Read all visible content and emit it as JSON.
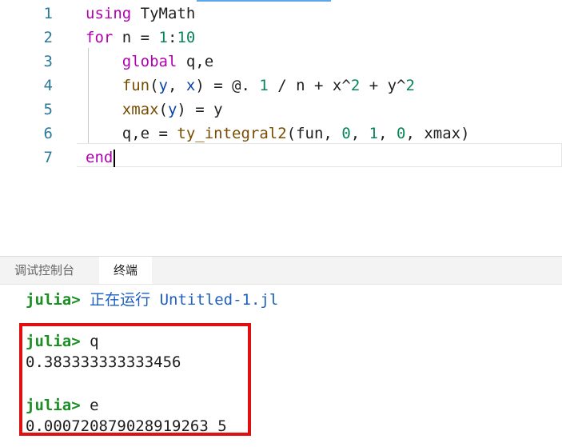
{
  "editor": {
    "lines": [
      {
        "num": "1",
        "parts": [
          {
            "t": "using",
            "c": "kw"
          },
          {
            "t": " TyMath",
            "c": ""
          }
        ]
      },
      {
        "num": "2",
        "parts": [
          {
            "t": "for",
            "c": "kw"
          },
          {
            "t": " n = ",
            "c": ""
          },
          {
            "t": "1",
            "c": "num"
          },
          {
            "t": ":",
            "c": ""
          },
          {
            "t": "10",
            "c": "num"
          }
        ]
      },
      {
        "num": "3",
        "parts": [
          {
            "t": "    global",
            "c": "kw"
          },
          {
            "t": " q,e",
            "c": ""
          }
        ]
      },
      {
        "num": "4",
        "parts": [
          {
            "t": "    fun",
            "c": "fn"
          },
          {
            "t": "(",
            "c": ""
          },
          {
            "t": "y",
            "c": "var"
          },
          {
            "t": ", ",
            "c": ""
          },
          {
            "t": "x",
            "c": "var"
          },
          {
            "t": ") = @. ",
            "c": ""
          },
          {
            "t": "1",
            "c": "num"
          },
          {
            "t": " / n + x^",
            "c": ""
          },
          {
            "t": "2",
            "c": "num"
          },
          {
            "t": " + y^",
            "c": ""
          },
          {
            "t": "2",
            "c": "num"
          }
        ]
      },
      {
        "num": "5",
        "parts": [
          {
            "t": "    xmax",
            "c": "fn"
          },
          {
            "t": "(",
            "c": ""
          },
          {
            "t": "y",
            "c": "var"
          },
          {
            "t": ") = y",
            "c": ""
          }
        ]
      },
      {
        "num": "6",
        "parts": [
          {
            "t": "    q,e = ",
            "c": ""
          },
          {
            "t": "ty_integral2",
            "c": "fn"
          },
          {
            "t": "(fun, ",
            "c": ""
          },
          {
            "t": "0",
            "c": "num"
          },
          {
            "t": ", ",
            "c": ""
          },
          {
            "t": "1",
            "c": "num"
          },
          {
            "t": ", ",
            "c": ""
          },
          {
            "t": "0",
            "c": "num"
          },
          {
            "t": ", xmax)",
            "c": ""
          }
        ]
      },
      {
        "num": "7",
        "parts": [
          {
            "t": "end",
            "c": "kw"
          }
        ]
      }
    ]
  },
  "panel": {
    "tabs": [
      {
        "label": "调试控制台",
        "active": false
      },
      {
        "label": "终端",
        "active": true
      }
    ],
    "terminal": {
      "prompt": "julia>",
      "run_text": "正在运行",
      "run_file": "Untitled-1.jl",
      "cmd_q": "q",
      "result_q": "0.383333333333456",
      "cmd_e": "e",
      "result_e": "0.000720879028919263 5"
    }
  },
  "colors": {
    "keyword": "#b000b0",
    "function": "#7a4c00",
    "number": "#098658",
    "prompt": "#1a8f23",
    "highlight_box": "#e01010"
  }
}
